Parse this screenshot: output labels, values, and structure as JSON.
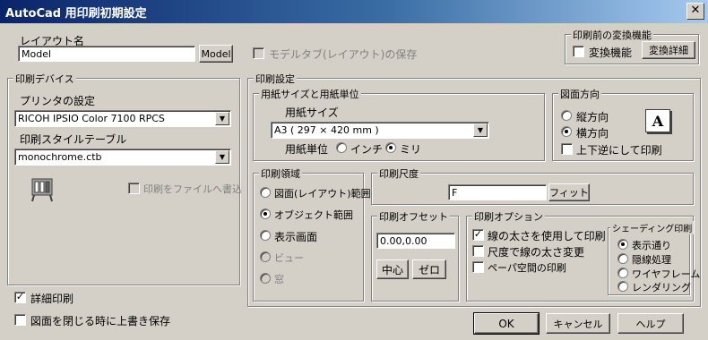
{
  "window": {
    "title": "AutoCad 用印刷初期設定",
    "close_glyph": "✕"
  },
  "layout_name": {
    "label": "レイアウト名",
    "value": "Model",
    "button": "Model",
    "save_model_tab": "モデルタブ(レイアウト)の保存"
  },
  "pre_convert": {
    "group": "印刷前の変換機能",
    "checkbox": "変換機能",
    "button": "変換詳細"
  },
  "device": {
    "group": "印刷デバイス",
    "printer_label": "プリンタの設定",
    "printer_value": "RICOH IPSIO Color 7100 RPCS",
    "style_label": "印刷スタイルテーブル",
    "style_value": "monochrome.ctb",
    "write_to_file": "印刷をファイルへ書込"
  },
  "settings": {
    "group": "印刷設定",
    "paper": {
      "group": "用紙サイズと用紙単位",
      "size_label": "用紙サイズ",
      "size_value": "A3 ( 297 × 420 mm )",
      "unit_label": "用紙単位",
      "unit_inch": "インチ",
      "unit_mm": "ミリ"
    },
    "orientation": {
      "group": "図面方向",
      "portrait": "縦方向",
      "landscape": "横方向",
      "upside_down": "上下逆にして印刷",
      "icon_letter": "A"
    },
    "area": {
      "group": "印刷領域",
      "items": [
        "図面(レイアウト)範囲",
        "オブジェクト範囲",
        "表示画面",
        "ビュー",
        "窓"
      ]
    },
    "scale": {
      "group": "印刷尺度",
      "value": "F",
      "fit_button": "フィット"
    },
    "offset": {
      "group": "印刷オフセット",
      "value": "0.00,0.00",
      "center_button": "中心",
      "zero_button": "ゼロ"
    },
    "options": {
      "group": "印刷オプション",
      "lineweight": "線の太さを使用して印刷",
      "scale_lineweight": "尺度で線の太さ変更",
      "paper_space": "ペーパ空間の印刷"
    },
    "shading": {
      "group": "シェーディング印刷",
      "items": [
        "表示通り",
        "隠線処理",
        "ワイヤフレーム",
        "レンダリング"
      ]
    }
  },
  "bottom": {
    "detail_print": "詳細印刷",
    "overwrite_save": "図面を閉じる時に上書き保存",
    "ok": "OK",
    "cancel": "キャンセル",
    "help": "ヘルプ"
  }
}
